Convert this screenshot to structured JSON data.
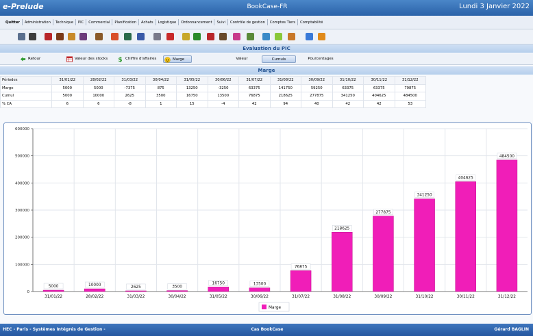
{
  "app": {
    "name": "e-Prelude",
    "title": "BookCase-FR",
    "date": "Lundi 3 Janvier 2022"
  },
  "menu": [
    "Quitter",
    "Administration",
    "Technique",
    "PIC",
    "Commercial",
    "Planification",
    "Achats",
    "Logistique",
    "Ordonnancement",
    "Suivi",
    "Contrôle de gestion",
    "Comptes Tiers",
    "Comptabilité"
  ],
  "toolbar_icons": [
    {
      "name": "save-icon",
      "color": "#5a6f8e"
    },
    {
      "name": "print-icon",
      "color": "#3d3d3d"
    },
    {
      "name": "tool-icon-1",
      "color": "#b8262a"
    },
    {
      "name": "tool-icon-2",
      "color": "#7a3a1a"
    },
    {
      "name": "tool-icon-3",
      "color": "#c88a2a"
    },
    {
      "name": "tool-icon-4",
      "color": "#6a3a7a"
    },
    {
      "name": "tool-icon-5",
      "color": "#8a5a2a"
    },
    {
      "name": "tool-icon-6",
      "color": "#d94f2a"
    },
    {
      "name": "tool-icon-7",
      "color": "#2a6a4a"
    },
    {
      "name": "tool-icon-8",
      "color": "#3a5aa8"
    },
    {
      "name": "tool-icon-9",
      "color": "#7a7a8a"
    },
    {
      "name": "tool-icon-10",
      "color": "#c82a2a"
    },
    {
      "name": "tool-icon-11",
      "color": "#c8a82a"
    },
    {
      "name": "tool-icon-12",
      "color": "#2a8a2a"
    },
    {
      "name": "tool-icon-13",
      "color": "#b8262a"
    },
    {
      "name": "tool-icon-14",
      "color": "#6a4a2a"
    },
    {
      "name": "tool-icon-15",
      "color": "#c83a8a"
    },
    {
      "name": "tool-icon-16",
      "color": "#5a8a3a"
    },
    {
      "name": "tool-icon-17",
      "color": "#3a8ac8"
    },
    {
      "name": "tool-icon-18",
      "color": "#8ac83a"
    },
    {
      "name": "tool-icon-19",
      "color": "#c8782a"
    },
    {
      "name": "help-icon",
      "color": "#3a7ad8"
    },
    {
      "name": "home-icon",
      "color": "#e08a1a"
    }
  ],
  "section_title": "Evaluation du PIC",
  "buttons": {
    "retour": "Retour",
    "valeur_stocks": "Valeur des stocks",
    "chiffre_affaires": "Chiffre d'affaires",
    "marge": "Marge",
    "valeur": "Valeur",
    "cumuls": "Cumuls",
    "pourcentages": "Pourcentages"
  },
  "subsection_title": "Marge",
  "table": {
    "header_label": "Périodes",
    "periods": [
      "31/01/22",
      "28/02/22",
      "31/03/22",
      "30/04/22",
      "31/05/22",
      "30/06/22",
      "31/07/22",
      "31/08/22",
      "30/09/22",
      "31/10/22",
      "30/11/22",
      "31/12/22"
    ],
    "rows": [
      {
        "label": "Marge",
        "values": [
          "5000",
          "5000",
          "-7375",
          "875",
          "13250",
          "-3250",
          "63375",
          "141750",
          "59250",
          "63375",
          "63375",
          "79875"
        ]
      },
      {
        "label": "Cumul",
        "values": [
          "5000",
          "10000",
          "2625",
          "3500",
          "16750",
          "13500",
          "76875",
          "218625",
          "277875",
          "341250",
          "404625",
          "484500"
        ]
      },
      {
        "label": "% CA",
        "values": [
          "6",
          "6",
          "-8",
          "1",
          "15",
          "-4",
          "42",
          "94",
          "40",
          "42",
          "42",
          "53"
        ]
      }
    ]
  },
  "chart_data": {
    "type": "bar",
    "categories": [
      "31/01/22",
      "28/02/22",
      "31/03/22",
      "30/04/22",
      "31/05/22",
      "30/06/22",
      "31/07/22",
      "31/08/22",
      "30/09/22",
      "31/10/22",
      "30/11/22",
      "31/12/22"
    ],
    "series": [
      {
        "name": "Marge",
        "values": [
          5000,
          10000,
          2625,
          3500,
          16750,
          13500,
          76875,
          218625,
          277875,
          341250,
          404625,
          484500
        ],
        "color": "#f01eb8"
      }
    ],
    "data_labels": [
      "5000",
      "10000",
      "2625",
      "3500",
      "16750",
      "13500",
      "76875",
      "218625",
      "277875",
      "341250",
      "404625",
      "484500"
    ],
    "yticks": [
      "0",
      "100000",
      "200000",
      "300000",
      "400000",
      "500000",
      "600000"
    ],
    "ylim": [
      0,
      600000
    ],
    "grid": true,
    "legend": "bottom-center"
  },
  "footer": {
    "left": "HEC - Paris - Systèmes Intégrés de Gestion -",
    "center": "Cas BookCase",
    "right": "Gérard BAGLIN"
  }
}
